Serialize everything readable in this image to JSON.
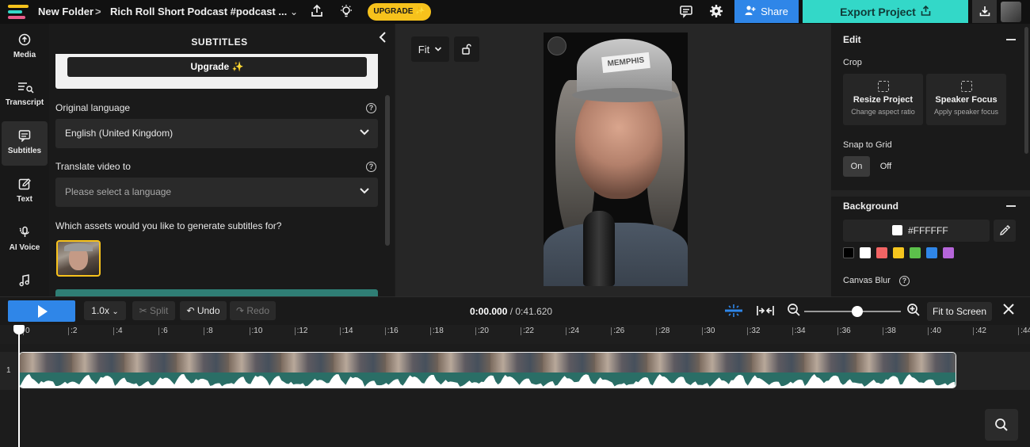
{
  "topbar": {
    "folder": "New Folder",
    "separator": ">",
    "project_title": "Rich Roll Short Podcast  #podcast ...",
    "upgrade_label": "UPGRADE ✨",
    "share_label": "Share",
    "export_label": "Export Project"
  },
  "rail": {
    "items": [
      {
        "label": "Media",
        "icon": "upload-icon"
      },
      {
        "label": "Transcript",
        "icon": "transcript-icon"
      },
      {
        "label": "Subtitles",
        "icon": "subtitles-icon"
      },
      {
        "label": "Text",
        "icon": "edit-text-icon"
      },
      {
        "label": "AI Voice",
        "icon": "ai-voice-icon"
      },
      {
        "label": "",
        "icon": "music-icon"
      }
    ]
  },
  "subtitles_panel": {
    "title": "SUBTITLES",
    "upgrade_button": "Upgrade ✨",
    "original_language_label": "Original language",
    "original_language_value": "English (United Kingdom)",
    "translate_label": "Translate video to",
    "translate_placeholder": "Please select a language",
    "assets_question": "Which assets would you like to generate subtitles for?"
  },
  "canvas": {
    "fit_label": "Fit",
    "cap_text": "MEMPHIS"
  },
  "edit_panel": {
    "title": "Edit",
    "crop_label": "Crop",
    "resize_title": "Resize Project",
    "resize_sub": "Change aspect ratio",
    "speaker_title": "Speaker Focus",
    "speaker_sub": "Apply speaker focus",
    "snap_label": "Snap to Grid",
    "snap_on": "On",
    "snap_off": "Off",
    "background_title": "Background",
    "background_color": "#FFFFFF",
    "swatches": [
      "#000000",
      "#FFFFFF",
      "#F26464",
      "#F5C51E",
      "#5CC04B",
      "#2F86E8",
      "#B565D9"
    ],
    "canvas_blur_label": "Canvas Blur"
  },
  "timeline": {
    "speed": "1.0x",
    "split": "✂ Split",
    "undo": "↶ Undo",
    "redo": "↷ Redo",
    "current_time": "0:00.000",
    "total_time": "/ 0:41.620",
    "fit_to_screen": "Fit to Screen",
    "track_number": "1",
    "ticks": [
      "0",
      ":2",
      ":4",
      ":6",
      ":8",
      ":10",
      ":12",
      ":14",
      ":16",
      ":18",
      ":20",
      ":22",
      ":24",
      ":26",
      ":28",
      ":30",
      ":32",
      ":34",
      ":36",
      ":38",
      ":40",
      ":42",
      ":44"
    ],
    "zoom_level": 0.55
  },
  "colors": {
    "accent_blue": "#2F86E8",
    "export_teal": "#33D8C8",
    "upgrade_yellow": "#F7C21C"
  }
}
